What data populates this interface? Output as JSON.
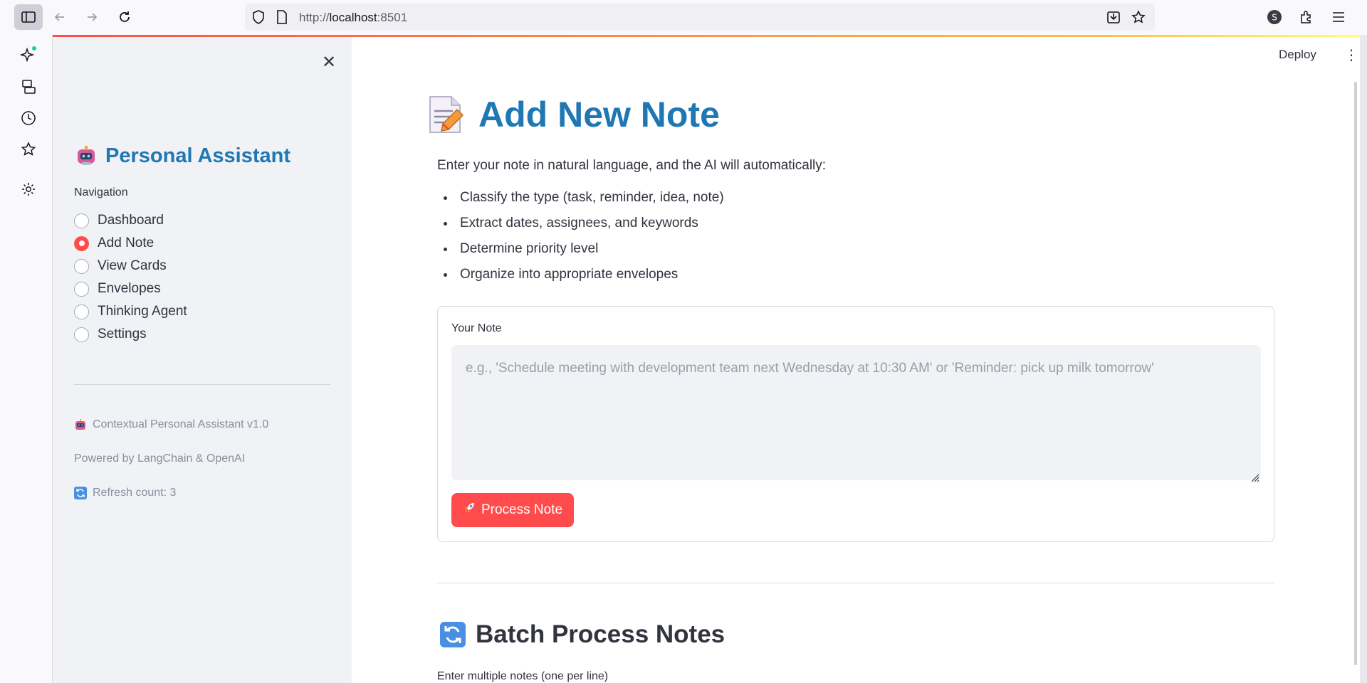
{
  "browser": {
    "url_prefix": "http://",
    "url_host": "localhost",
    "url_port": ":8501"
  },
  "sidebar": {
    "title": "Personal Assistant",
    "nav_label": "Navigation",
    "items": [
      {
        "label": "Dashboard",
        "selected": false
      },
      {
        "label": "Add Note",
        "selected": true
      },
      {
        "label": "View Cards",
        "selected": false
      },
      {
        "label": "Envelopes",
        "selected": false
      },
      {
        "label": "Thinking Agent",
        "selected": false
      },
      {
        "label": "Settings",
        "selected": false
      }
    ],
    "footer": {
      "version": "Contextual Personal Assistant v1.0",
      "powered": "Powered by LangChain & OpenAI",
      "refresh": "Refresh count: 3"
    }
  },
  "header": {
    "deploy_label": "Deploy"
  },
  "main": {
    "title": "Add New Note",
    "intro": "Enter your note in natural language, and the AI will automatically:",
    "bullets": [
      "Classify the type (task, reminder, idea, note)",
      "Extract dates, assignees, and keywords",
      "Determine priority level",
      "Organize into appropriate envelopes"
    ],
    "note_label": "Your Note",
    "note_value": "",
    "note_placeholder": "e.g., 'Schedule meeting with development team next Wednesday at 10:30 AM' or 'Reminder: pick up milk tomorrow'",
    "process_button": "Process Note",
    "batch_title": "Batch Process Notes",
    "batch_sub": "Enter multiple notes (one per line)"
  },
  "colors": {
    "accent": "#ff4b4b",
    "title_blue": "#1f77b4",
    "sidebar_bg": "#f0f2f6"
  }
}
